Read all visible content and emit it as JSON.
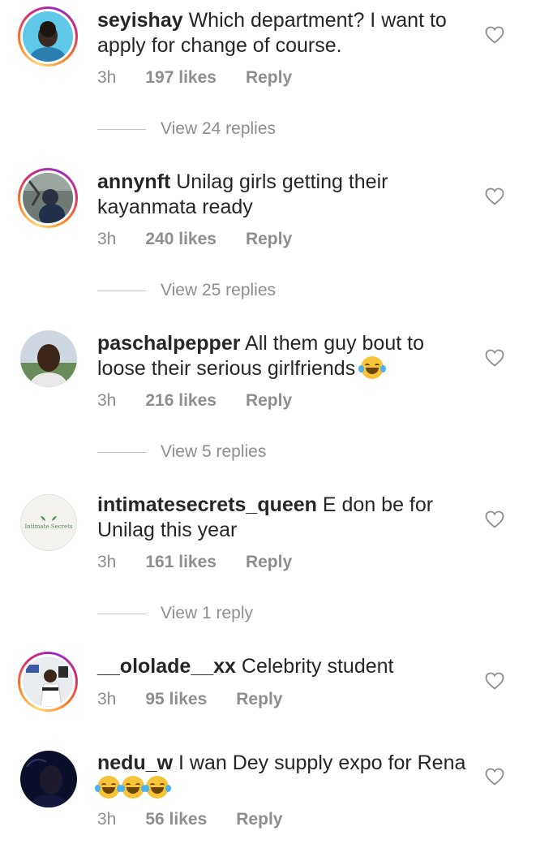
{
  "comments": [
    {
      "username": "seyishay",
      "text": " Which department? I want to apply for change of course.",
      "time": "3h",
      "likes": "197 likes",
      "reply": "Reply",
      "view_replies": "View 24 replies"
    },
    {
      "username": "annynft",
      "text": " Unilag girls getting their kayanmata ready",
      "time": "3h",
      "likes": "240 likes",
      "reply": "Reply",
      "view_replies": "View 25 replies"
    },
    {
      "username": "paschalpepper",
      "text": " All them guy bout to loose their serious girlfriends ",
      "time": "3h",
      "likes": "216 likes",
      "reply": "Reply",
      "view_replies": "View 5 replies"
    },
    {
      "username": "intimatesecrets_queen",
      "text": " E don be for Unilag this year",
      "time": "3h",
      "likes": "161 likes",
      "reply": "Reply",
      "view_replies": "View 1 reply",
      "avatar_text": "Intimate Secrets"
    },
    {
      "username": "__ololade__xx",
      "text": " Celebrity student",
      "time": "3h",
      "likes": "95 likes",
      "reply": "Reply"
    },
    {
      "username": "nedu_w",
      "text": " I wan Dey supply expo for Rena",
      "time": "3h",
      "likes": "56 likes",
      "reply": "Reply"
    }
  ],
  "icons": {
    "like": "heart-outline-icon",
    "emoji": "face-with-tears-of-joy-icon"
  },
  "colors": {
    "text": "#262626",
    "meta": "#8e8e8e",
    "story_ring": "#d62976"
  }
}
